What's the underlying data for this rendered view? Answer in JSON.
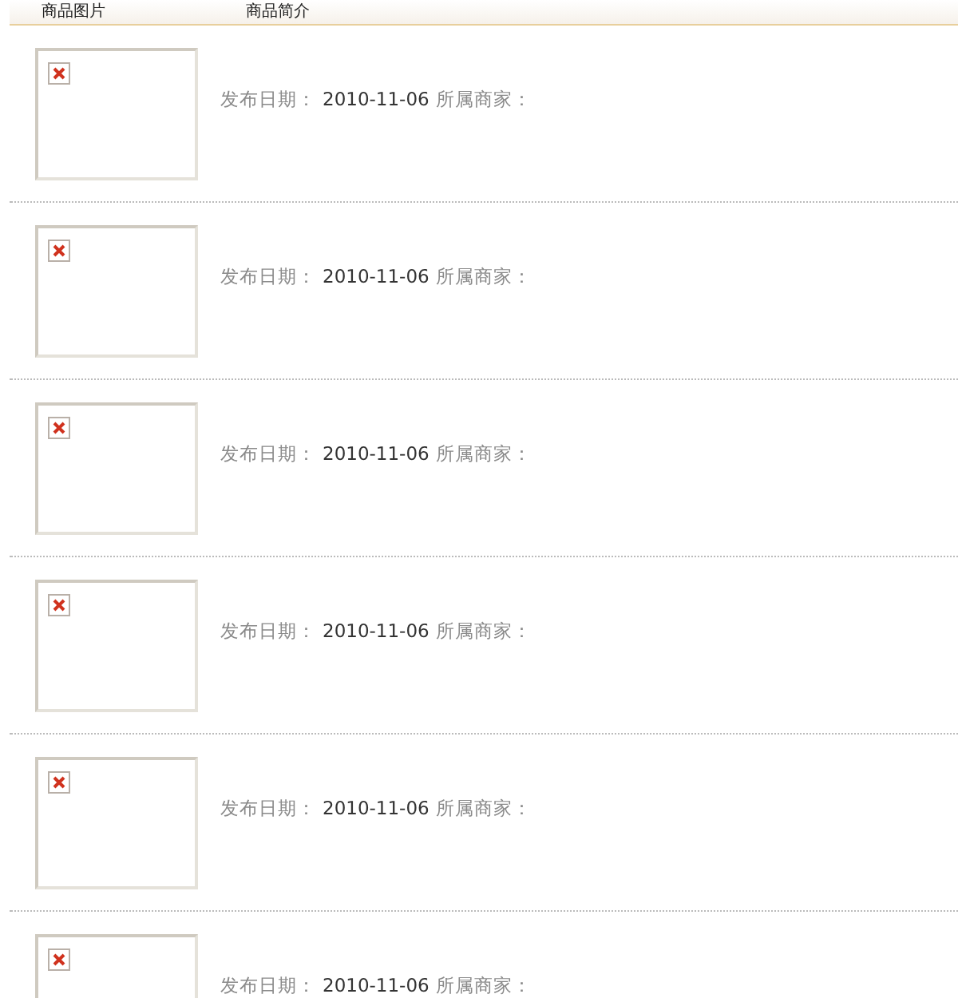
{
  "table": {
    "columns": [
      "商品图片",
      "商品简介"
    ],
    "rows": [
      {
        "image": {
          "kind": "broken"
        },
        "date_label": "发布日期：",
        "date": "2010-11-06",
        "merchant_label": "所属商家："
      },
      {
        "image": {
          "kind": "broken"
        },
        "date_label": "发布日期：",
        "date": "2010-11-06",
        "merchant_label": "所属商家："
      },
      {
        "image": {
          "kind": "broken"
        },
        "date_label": "发布日期：",
        "date": "2010-11-06",
        "merchant_label": "所属商家："
      },
      {
        "image": {
          "kind": "broken"
        },
        "date_label": "发布日期：",
        "date": "2010-11-06",
        "merchant_label": "所属商家："
      },
      {
        "image": {
          "kind": "broken"
        },
        "date_label": "发布日期：",
        "date": "2010-11-06",
        "merchant_label": "所属商家："
      },
      {
        "image": {
          "kind": "broken"
        },
        "date_label": "发布日期：",
        "date": "2010-11-06",
        "merchant_label": "所属商家："
      }
    ]
  }
}
